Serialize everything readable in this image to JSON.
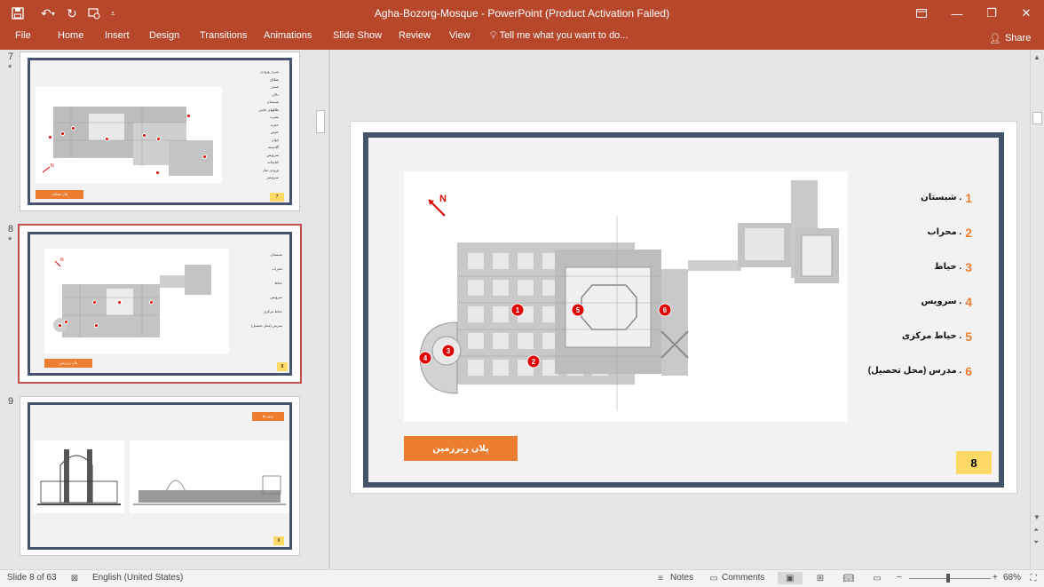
{
  "window": {
    "title": "Agha-Bozorg-Mosque - PowerPoint (Product Activation Failed)"
  },
  "ribbon": {
    "tabs": [
      "File",
      "Home",
      "Insert",
      "Design",
      "Transitions",
      "Animations",
      "Slide Show",
      "Review",
      "View"
    ],
    "tell_me": "Tell me what you want to do...",
    "share": "Share"
  },
  "thumbnails": [
    {
      "number": "7",
      "star": "*",
      "legend": [
        "سردر ورودی",
        "مطاق",
        "صحن",
        "دالان",
        "شبستان",
        "طاقهای جانبی",
        "مقبره",
        "حجره",
        "حوض",
        "ایوان",
        "گلدسته",
        "سرویس",
        "کتابخانه",
        "ورودی ساز",
        "سرویس"
      ],
      "button": "پلان همکف",
      "slide_number": "7"
    },
    {
      "number": "8",
      "star": "*",
      "legend": [
        "شبستان",
        "محراب",
        "حیاط",
        "سرویس",
        "حیاط مرکزی",
        "مدرس (محل تحصیل)"
      ],
      "button": "پلان زیرزمین",
      "slide_number": "8"
    },
    {
      "number": "9",
      "button": "برش ها",
      "slide_number": "9"
    }
  ],
  "slide": {
    "north_label": "N",
    "legend": [
      {
        "num": "1",
        "text": ". شبستان"
      },
      {
        "num": "2",
        "text": ". محراب"
      },
      {
        "num": "3",
        "text": ". حیاط"
      },
      {
        "num": "4",
        "text": ". سرویس"
      },
      {
        "num": "5",
        "text": ". حیاط مرکزی"
      },
      {
        "num": "6",
        "text": ". مدرس (محل تحصیل)"
      }
    ],
    "markers": [
      "1",
      "2",
      "3",
      "4",
      "5",
      "6"
    ],
    "plan_button": "پلان زیرزمین",
    "slide_number": "8"
  },
  "status": {
    "slide_info": "Slide 8 of 63",
    "language": "English (United States)",
    "notes": "Notes",
    "comments": "Comments",
    "zoom": "68%"
  },
  "colors": {
    "ribbon": "#b7472a",
    "frame": "#44546a",
    "accent": "#ed7d31",
    "number_box": "#ffd966",
    "marker": "#e00000"
  }
}
